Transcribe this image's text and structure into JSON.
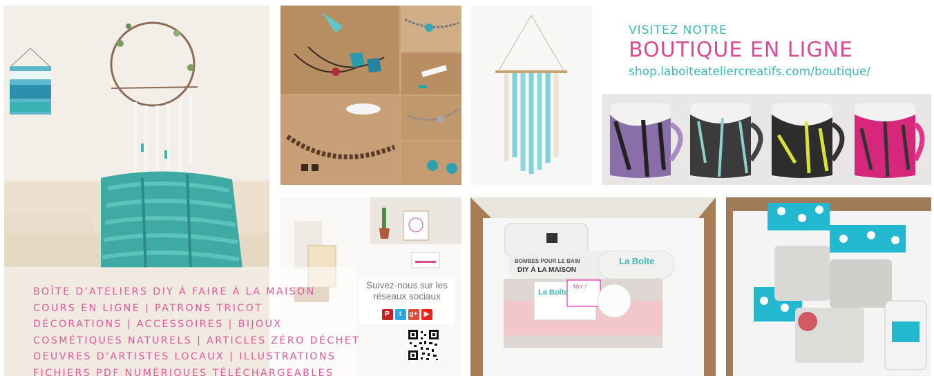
{
  "shop": {
    "kicker": "VISITEZ NOTRE",
    "title": "BOUTIQUE EN LIGNE",
    "url": "shop.laboiteateliercreatifs.com/boutique/"
  },
  "categories": [
    "BOÎTE D'ATELIERS DIY À FAIRE À LA MAISON",
    "COURS EN LIGNE | PATRONS TRICOT",
    "DÉCORATIONS | ACCESSOIRES | BIJOUX",
    "COSMÉTIQUES NATURELS | ARTICLES ZÉRO DÉCHET",
    "OEUVRES D'ARTISTES LOCAUX | ILLUSTRATIONS",
    "FICHIERS PDF NUMÉRIQUES TÉLÉCHARGEABLES"
  ],
  "social": {
    "text": "Suivez-nous sur les réseaux sociaux",
    "icons": [
      {
        "name": "pinterest-icon",
        "glyph": "P",
        "color": "#cb2027"
      },
      {
        "name": "twitter-icon",
        "glyph": "t",
        "color": "#2aa9e0"
      },
      {
        "name": "google-plus-icon",
        "glyph": "g+",
        "color": "#dd4b39"
      },
      {
        "name": "youtube-icon",
        "glyph": "▶",
        "color": "#e62117"
      }
    ]
  },
  "box_labels": {
    "bath_bombs": "BOMBES POUR LE BAIN",
    "diy": "DIY À LA MAISON",
    "brand": "La Boîte",
    "note": "Mer !"
  },
  "colors": {
    "teal": "#3fb6b4",
    "pink": "#d94b94"
  }
}
